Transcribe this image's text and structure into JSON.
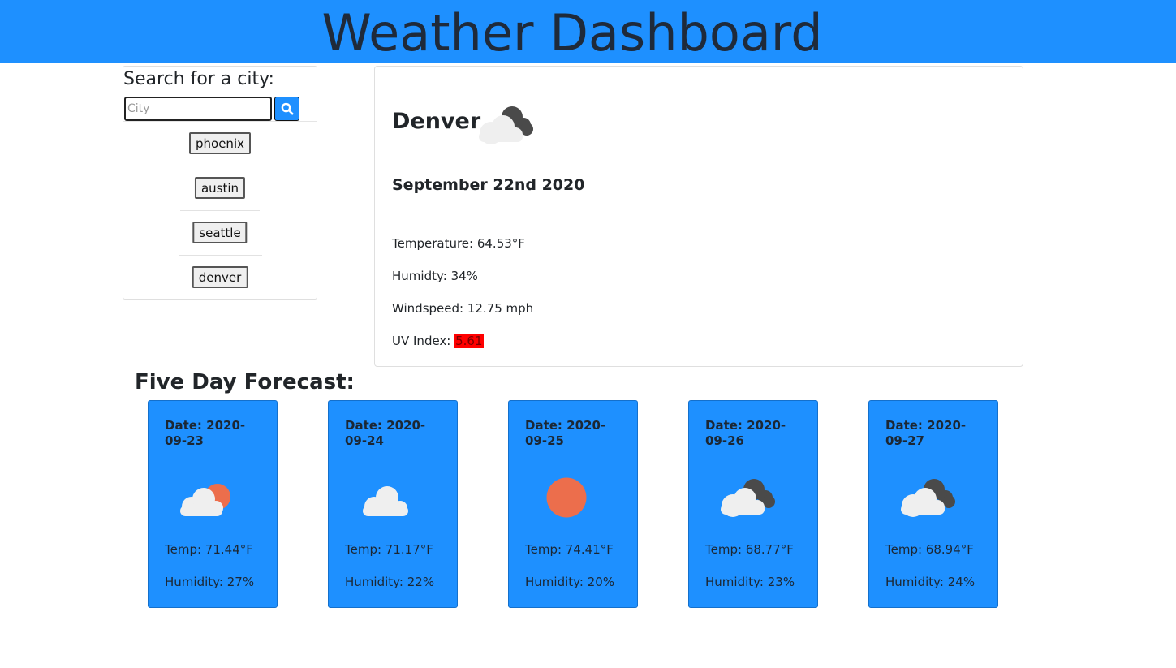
{
  "header": {
    "title": "Weather Dashboard",
    "color": "#1e90ff"
  },
  "search": {
    "heading": "Search for a city:",
    "placeholder": "City",
    "button_icon": "search-icon",
    "history": [
      "phoenix",
      "austin",
      "seattle",
      "denver"
    ]
  },
  "current": {
    "city": "Denver",
    "icon": "broken-clouds-icon",
    "date": "September 22nd 2020",
    "temperature": "Temperature: 64.53°F",
    "humidity": "Humidty: 34%",
    "windspeed": "Windspeed: 12.75 mph",
    "uv_label": "UV Index: ",
    "uv_value": "5.61",
    "uv_color": "#ff0000"
  },
  "forecast": {
    "heading": "Five Day Forecast:",
    "days": [
      {
        "date": "Date: 2020-09-23",
        "icon": "partly-cloudy-icon",
        "temp": "Temp: 71.44°F",
        "humidity": "Humidity: 27%"
      },
      {
        "date": "Date: 2020-09-24",
        "icon": "cloud-icon",
        "temp": "Temp: 71.17°F",
        "humidity": "Humidity: 22%"
      },
      {
        "date": "Date: 2020-09-25",
        "icon": "sun-icon",
        "temp": "Temp: 74.41°F",
        "humidity": "Humidity: 20%"
      },
      {
        "date": "Date: 2020-09-26",
        "icon": "broken-clouds-icon",
        "temp": "Temp: 68.77°F",
        "humidity": "Humidity: 23%"
      },
      {
        "date": "Date: 2020-09-27",
        "icon": "broken-clouds-icon",
        "temp": "Temp: 68.94°F",
        "humidity": "Humidity: 24%"
      }
    ]
  }
}
